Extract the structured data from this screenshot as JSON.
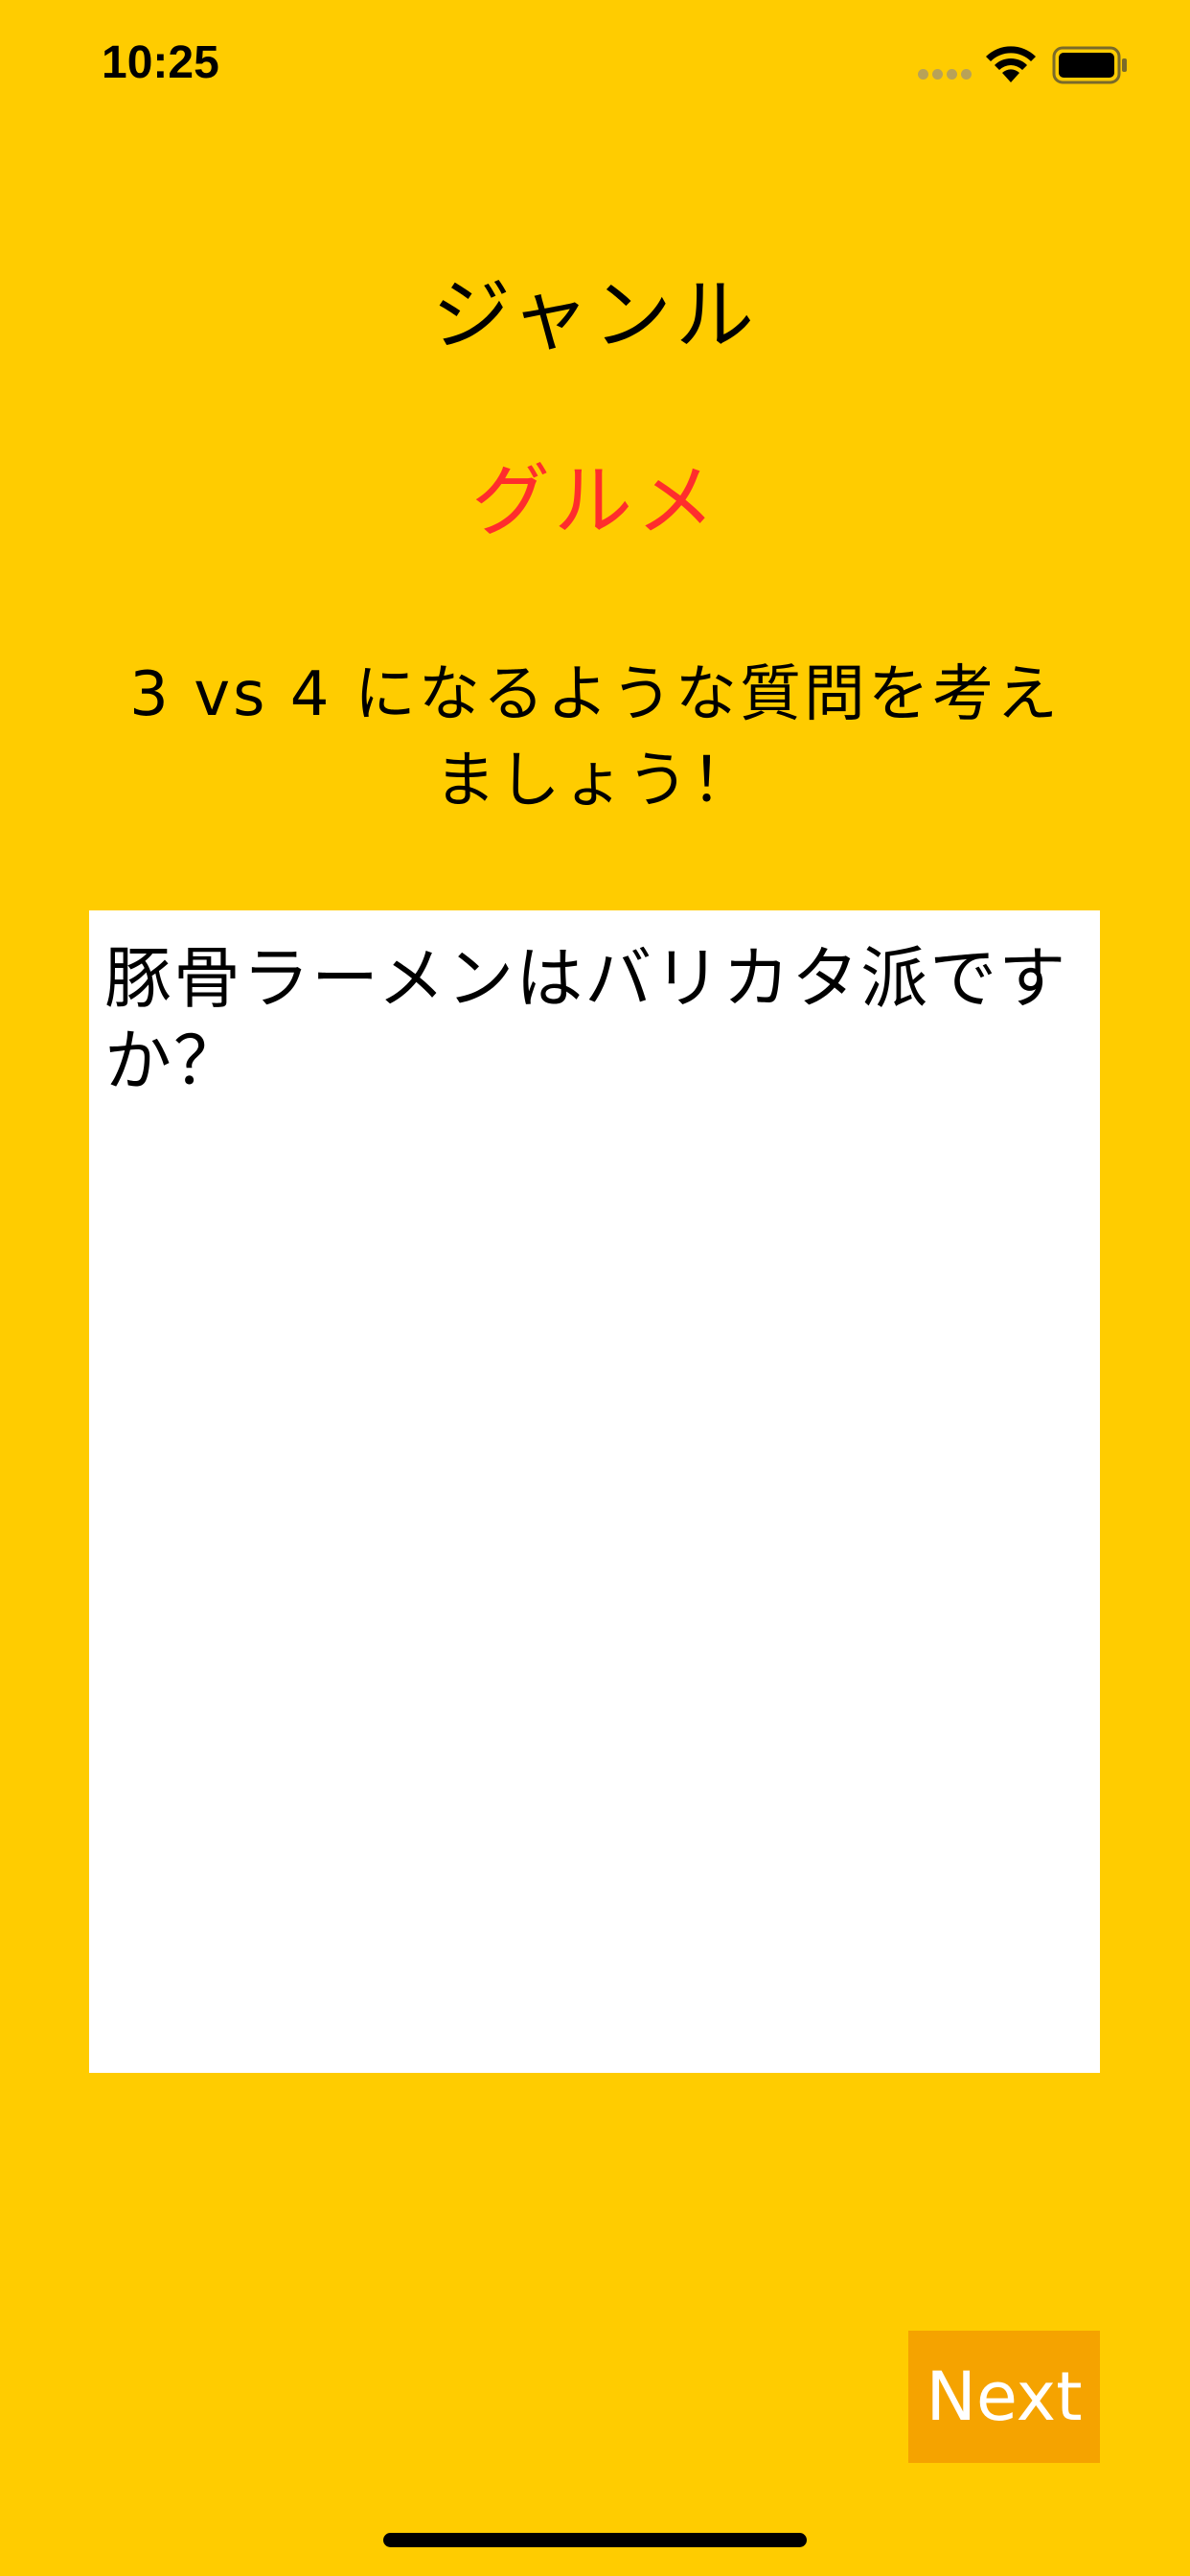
{
  "status_bar": {
    "time": "10:25",
    "signal_icon": "cellular-signal-icon",
    "wifi_icon": "wifi-icon",
    "battery_icon": "battery-icon"
  },
  "genre": {
    "heading": "ジャンル",
    "value": "グルメ"
  },
  "instruction": {
    "text": "3 vs 4 になるような質問を考えましょう！"
  },
  "question": {
    "value": "豚骨ラーメンはバリカタ派ですか？"
  },
  "next_button": {
    "label": "Next"
  },
  "colors": {
    "background": "#FFCC00",
    "genre_value": "#FF2D2D",
    "next_button": "#F5A300",
    "question_box": "#FFFFFF"
  }
}
